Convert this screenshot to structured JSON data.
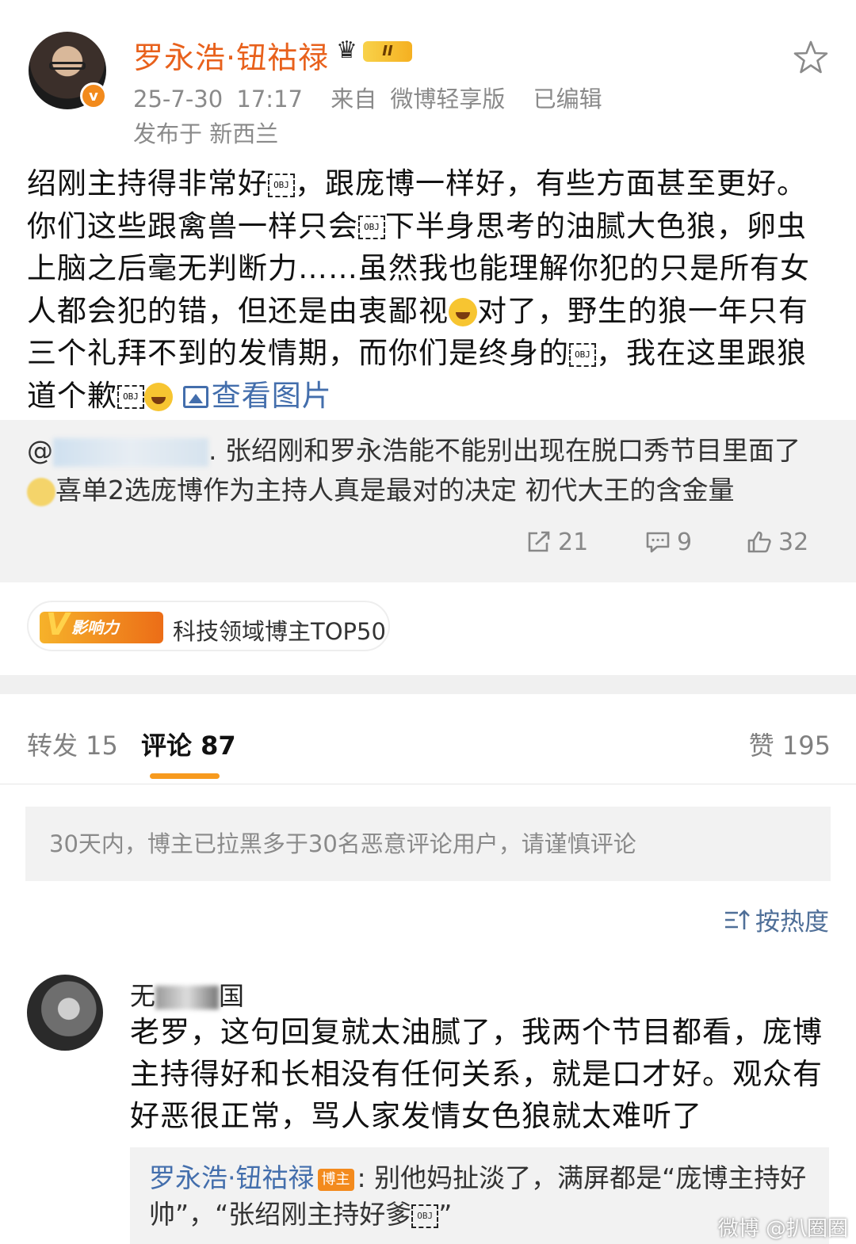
{
  "post": {
    "username": "罗永浩·钮祜禄",
    "vip_level": "II",
    "verified_mark": "v",
    "timestamp": "25-7-30 17:17",
    "source": "来自 微博轻享版",
    "edited": "已编辑",
    "location": "发布于 新西兰",
    "body_segments": [
      "绍刚主持得非常好",
      "，跟庞博一样好，有些方面甚至更好。你们这些跟禽兽一样只会",
      "下半身思考的油腻大色狼，卵虫上脑之后毫无判断力……虽然我也能理解你犯的只是所有女人都会犯的错，但还是由衷鄙视",
      "对了，野生的狼一年只有三个礼拜不到的发情期，而你们是终身的",
      "，我在这里跟狼道个歉"
    ],
    "obj_placeholder": "OBJ",
    "view_images": "查看图片"
  },
  "repost": {
    "text_line1": ". 张绍刚和罗永浩能不能别出现在脱口秀节目里面了",
    "at_sign": "@",
    "text_line2": "喜单2选庞博作为主持人真是最对的决定 初代大王的含金量"
  },
  "actions": {
    "repost_count": "21",
    "comment_count": "9",
    "like_count": "32"
  },
  "influence": {
    "tag": "影响力",
    "tag_letter": "V",
    "label": "科技领域博主TOP50"
  },
  "tabs": {
    "repost": "转发 15",
    "comment": "评论 87",
    "like": "赞 195"
  },
  "notice": "30天内，博主已拉黑多于30名恶意评论用户，请谨慎评论",
  "sort_label": "按热度",
  "comment": {
    "name_prefix": "无",
    "name_suffix": "国",
    "body": "老罗，这句回复就太油腻了，我两个节目都看，庞博主持得好和长相没有任何关系，就是口才好。观众有好恶很正常，骂人家发情女色狼就太难听了",
    "reply_author": "罗永浩·钮祜禄",
    "reply_tag": "博主",
    "reply_text_1": ": 别他妈扯淡了，满屏都是“庞博主持好帅”，“张绍刚主持好爹",
    "reply_text_2": "”"
  },
  "watermark": "微博 @扒圈圈",
  "colors": {
    "brand_orange": "#e8611c",
    "link_blue": "#436eac",
    "muted_gray": "#8a8a8a",
    "tab_underline": "#f79a1e"
  }
}
